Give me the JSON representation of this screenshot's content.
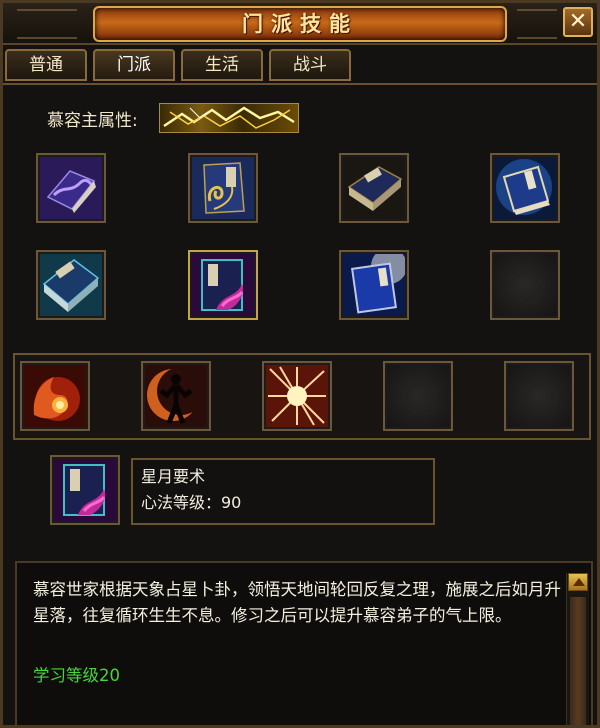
{
  "window": {
    "title": "门派技能",
    "close_label": "✕"
  },
  "tabs": [
    {
      "label": "普通",
      "active": false
    },
    {
      "label": "门派",
      "active": true
    },
    {
      "label": "生活",
      "active": false
    },
    {
      "label": "战斗",
      "active": false
    }
  ],
  "attribute": {
    "label": "慕容主属性:",
    "element_icon": "lightning-icon"
  },
  "book_grid": [
    {
      "icon": "purple-wave-book-icon"
    },
    {
      "icon": "golden-swirl-book-icon"
    },
    {
      "icon": "dark-blue-book-icon"
    },
    {
      "icon": "glowing-blue-book-icon"
    },
    {
      "icon": "teal-book-icon"
    },
    {
      "icon": "magenta-book-icon"
    },
    {
      "icon": "bright-blue-book-icon"
    },
    {
      "icon": "empty-slot-icon"
    }
  ],
  "skill_strip": [
    {
      "icon": "fire-palm-icon"
    },
    {
      "icon": "moon-figure-icon"
    },
    {
      "icon": "burst-explosion-icon"
    },
    {
      "icon": "empty-slot-icon"
    },
    {
      "icon": "empty-slot-icon"
    }
  ],
  "selected": {
    "icon": "magenta-book-icon",
    "name": "星月要术",
    "level_text": "心法等级：90"
  },
  "description": {
    "text": "慕容世家根据天象占星卜卦，领悟天地间轮回反复之理，施展之后如月升星落，往复循环生生不息。修习之后可以提升慕容弟子的气上限。",
    "requirement": "学习等级20"
  },
  "colors": {
    "accent": "#e0a64a",
    "requirement": "#46d63a",
    "text": "#f4f0e0"
  }
}
